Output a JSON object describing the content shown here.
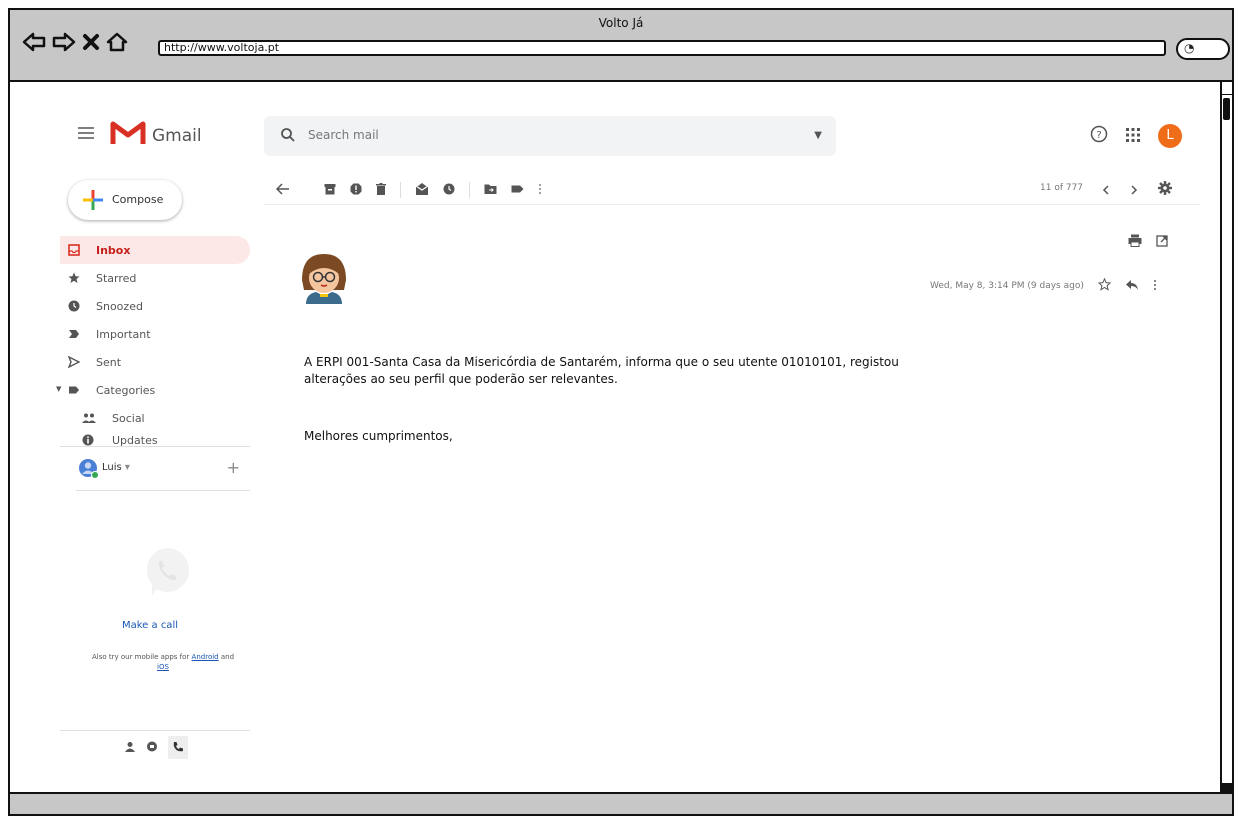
{
  "window": {
    "title": "Volto Já"
  },
  "browser": {
    "url": "http://www.voltoja.pt"
  },
  "gmail": {
    "logo_text": "Gmail",
    "search_placeholder": "Search mail",
    "avatar_letter": "L",
    "compose_label": "Compose",
    "nav": [
      {
        "label": "Inbox",
        "icon": "inbox-icon"
      },
      {
        "label": "Starred",
        "icon": "star-icon"
      },
      {
        "label": "Snoozed",
        "icon": "clock-icon"
      },
      {
        "label": "Important",
        "icon": "important-icon"
      },
      {
        "label": "Sent",
        "icon": "send-icon"
      },
      {
        "label": "Categories",
        "icon": "label-icon"
      },
      {
        "label": "Social",
        "icon": "people-icon"
      },
      {
        "label": "Updates",
        "icon": "info-icon"
      }
    ],
    "user_name": "Luis",
    "make_call": "Make a call",
    "apps_note_pre": "Also try our mobile apps for",
    "apps_android": "Android",
    "apps_and": "and",
    "apps_ios": "iOS",
    "pager": "11 of 777",
    "message": {
      "date": "Wed, May 8, 3:14 PM (9 days ago)",
      "body_line1": "A ERPI 001-Santa Casa da Misericórdia de Santarém, informa que o seu utente 01010101, registou",
      "body_line2": "alterações ao seu perfil que poderão ser relevantes.",
      "signoff": "Melhores cumprimentos,"
    }
  }
}
